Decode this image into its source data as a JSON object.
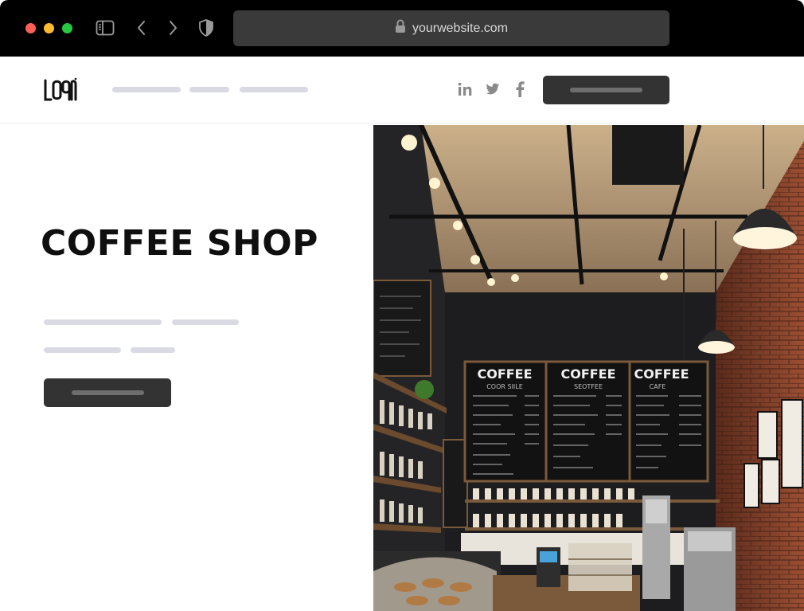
{
  "browser": {
    "url": "yourwebsite.com",
    "icons": [
      "sidebar-icon",
      "back-icon",
      "forward-icon",
      "shield-icon",
      "lock-icon"
    ]
  },
  "header": {
    "logo_alt": "logo",
    "social": [
      "linkedin-icon",
      "twitter-icon",
      "facebook-icon"
    ]
  },
  "hero": {
    "title": "COFFEE SHOP",
    "image": {
      "menu_boards": [
        {
          "heading": "COFFEE",
          "subheading": "COOR SIILE"
        },
        {
          "heading": "COFFEE",
          "subheading": "SEOTFEE"
        },
        {
          "heading": "COFFEE",
          "subheading": "CAFE"
        }
      ]
    }
  },
  "colors": {
    "chrome": "#000000",
    "address_bar": "#3a3a3a",
    "button": "#333333",
    "placeholder": "#dadae4",
    "title": "#0f0f10"
  }
}
